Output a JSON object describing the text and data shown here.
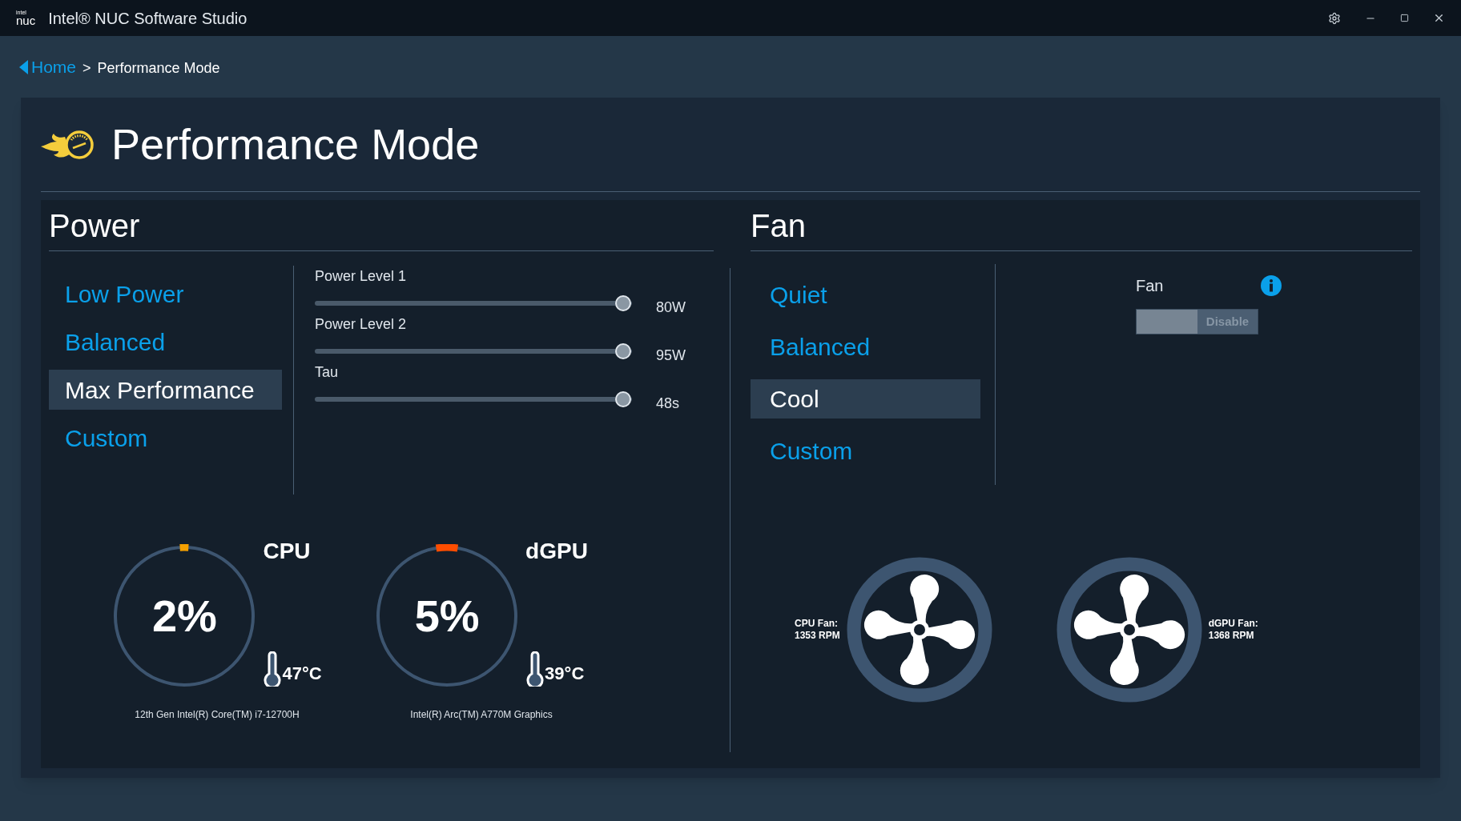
{
  "window": {
    "logo": {
      "top": "intel",
      "bottom": "nuc"
    },
    "title": "Intel® NUC Software Studio"
  },
  "breadcrumb": {
    "home": "Home",
    "separator": ">",
    "current": "Performance Mode"
  },
  "page_title": "Performance Mode",
  "power": {
    "title": "Power",
    "modes": [
      {
        "label": "Low Power",
        "selected": false
      },
      {
        "label": "Balanced",
        "selected": false
      },
      {
        "label": "Max Performance",
        "selected": true
      },
      {
        "label": "Custom",
        "selected": false
      }
    ],
    "sliders": [
      {
        "label": "Power Level 1",
        "level": 1,
        "reading": "80W"
      },
      {
        "label": "Power Level 2",
        "level": 1,
        "reading": "95W"
      },
      {
        "label": "Tau",
        "level": 1,
        "reading": "48s"
      }
    ],
    "gauges": [
      {
        "name": "CPU",
        "value": "2%",
        "level": 0.02,
        "color": "#f5a000",
        "temperature": "47°C",
        "model": "12th Gen Intel(R) Core(TM) i7-12700H"
      },
      {
        "name": "dGPU",
        "value": "5%",
        "level": 0.05,
        "color": "#ff4d00",
        "temperature": "39°C",
        "model": "Intel(R) Arc(TM) A770M Graphics"
      }
    ]
  },
  "fan": {
    "title": "Fan",
    "modes": [
      {
        "label": "Quiet",
        "selected": false
      },
      {
        "label": "Balanced",
        "selected": false
      },
      {
        "label": "Cool",
        "selected": true
      },
      {
        "label": "Custom",
        "selected": false
      }
    ],
    "control": {
      "label": "Fan",
      "on": false,
      "state_text": "Disable"
    },
    "fans": [
      {
        "label": "CPU Fan:",
        "reading": "1353 RPM"
      },
      {
        "label": "dGPU Fan:",
        "reading": "1368 RPM"
      }
    ]
  }
}
